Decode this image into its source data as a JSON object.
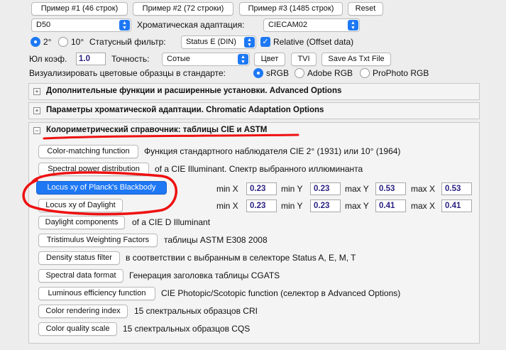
{
  "top_buttons": {
    "example1": "Пример #1 (46 строк)",
    "example2": "Пример #2 (72 строки)",
    "example3": "Пример #3 (1485 строк)",
    "reset": "Reset"
  },
  "illuminant_select": "D50",
  "chromatic_adaptation": {
    "label": "Хроматическая адаптация:",
    "value": "CIECAM02"
  },
  "observer": {
    "opt1": "2°",
    "opt2": "10°",
    "selected": "2°"
  },
  "status_filter": {
    "label": "Статусный фильтр:",
    "value": "Status E (DIN)"
  },
  "relative": {
    "label": "Relative (Offset data)",
    "checked": true
  },
  "yul": {
    "label": "Юл коэф.",
    "value": "1.0"
  },
  "precision": {
    "label": "Точность:",
    "value": "Сотые"
  },
  "tool_buttons": {
    "color": "Цвет",
    "tvi": "TVI",
    "save": "Save As Txt File"
  },
  "visualize": {
    "label": "Визуализировать цветовые образцы в стандарте:",
    "options": [
      "sRGB",
      "Adobe RGB",
      "ProPhoto RGB"
    ],
    "selected": "sRGB"
  },
  "panels": {
    "advanced": "Дополнительные функции и расширенные установки. Advanced Options",
    "chromatic": "Параметры хроматической адаптации. Chromatic Adaptation Options",
    "colorimetric": "Колориметрический справочник: таблицы CIE и ASTM"
  },
  "reference_rows": [
    {
      "button": "Color-matching function",
      "desc": "Функция стандартного наблюдателя CIE 2° (1931) или 10° (1964)"
    },
    {
      "button": "Spectral power distribution",
      "desc": "of a CIE Illuminant. Спектр выбранного иллюминанта"
    },
    {
      "button": "Locus xy of Planck's Blackbody",
      "desc": ""
    },
    {
      "button": "Locus xy of Daylight",
      "desc": ""
    },
    {
      "button": "Daylight components",
      "desc": "of a CIE D Illuminant"
    },
    {
      "button": "Tristimulus Weighting Factors",
      "desc": "таблицы ASTM E308 2008"
    },
    {
      "button": "Density status filter",
      "desc": "в соответствии с выбранным в селекторе Status A, E, M, T"
    },
    {
      "button": "Spectral data format",
      "desc": "Генерация заголовка таблицы CGATS"
    },
    {
      "button": "Luminous efficiency function",
      "desc": "CIE Photopic/Scotopic function (селектор в Advanced Options)"
    },
    {
      "button": "Color rendering index",
      "desc": "15 спектральных образцов CRI"
    },
    {
      "button": "Color quality scale",
      "desc": "15 спектральных образцов CQS"
    }
  ],
  "locus_labels": {
    "minx": "min X",
    "miny": "min Y",
    "maxy": "max Y",
    "maxx": "max X"
  },
  "planck_range": {
    "minx": "0.23",
    "miny": "0.23",
    "maxy": "0.53",
    "maxx": "0.53"
  },
  "daylight_range": {
    "minx": "0.23",
    "miny": "0.23",
    "maxy": "0.41",
    "maxx": "0.41"
  },
  "colors": {
    "accent": "#1e78f4",
    "annotation_red": "#ee1111",
    "value_text": "#2a2280"
  }
}
